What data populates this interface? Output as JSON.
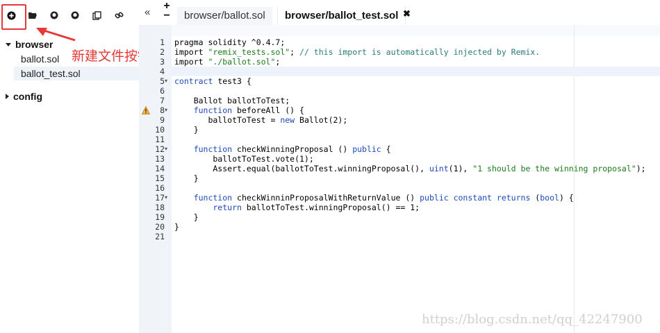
{
  "toolbar": {
    "buttons": [
      {
        "icon": "plus-circle-icon",
        "glyph": "⊕"
      },
      {
        "icon": "folder-open-icon",
        "glyph": "📂"
      },
      {
        "icon": "github-icon",
        "glyph": "◑"
      },
      {
        "icon": "github-icon",
        "glyph": "◑"
      },
      {
        "icon": "copy-icon",
        "glyph": "⧉"
      },
      {
        "icon": "link-icon",
        "glyph": "🔗"
      }
    ]
  },
  "annotation": {
    "text": "新建文件按钮",
    "color": "#e53935"
  },
  "tree": {
    "folders": [
      {
        "label": "browser",
        "expanded": true,
        "files": [
          {
            "label": "ballot.sol"
          },
          {
            "label": "ballot_test.sol",
            "active": true
          }
        ]
      },
      {
        "label": "config",
        "expanded": false
      }
    ]
  },
  "tabs": {
    "left_arrow": "«",
    "plus": "+",
    "minus": "−",
    "items": [
      {
        "label": "browser/ballot.sol",
        "active": false
      },
      {
        "label": "browser/ballot_test.sol",
        "active": true
      }
    ],
    "close": "✖"
  },
  "editor": {
    "current_line": 4,
    "warning_line": 8,
    "lines": [
      {
        "n": "1",
        "tokens": [
          [
            "kw2",
            "pragma solidity "
          ],
          [
            "op",
            "^"
          ],
          [
            "num",
            "0.4.7"
          ],
          [
            "op",
            ";"
          ]
        ]
      },
      {
        "n": "2",
        "tokens": [
          [
            "id",
            "import "
          ],
          [
            "str",
            "\"remix_tests.sol\""
          ],
          [
            "op",
            "; "
          ],
          [
            "cm",
            "// this import is automatically injected by Remix."
          ]
        ]
      },
      {
        "n": "3",
        "tokens": [
          [
            "id",
            "import "
          ],
          [
            "str",
            "\"./ballot.sol\""
          ],
          [
            "op",
            ";"
          ]
        ]
      },
      {
        "n": "4",
        "tokens": []
      },
      {
        "n": "5",
        "fold": true,
        "tokens": [
          [
            "kw",
            "contract"
          ],
          [
            "id",
            " test3 {"
          ]
        ]
      },
      {
        "n": "6",
        "tokens": []
      },
      {
        "n": "7",
        "tokens": [
          [
            "id",
            "    Ballot ballotToTest;"
          ]
        ]
      },
      {
        "n": "8",
        "fold": true,
        "tokens": [
          [
            "kw",
            "    function "
          ],
          [
            "id",
            "beforeAll () {"
          ]
        ]
      },
      {
        "n": "9",
        "tokens": [
          [
            "id",
            "       ballotToTest = "
          ],
          [
            "kw",
            "new"
          ],
          [
            "id",
            " Ballot(2);"
          ]
        ]
      },
      {
        "n": "10",
        "tokens": [
          [
            "id",
            "    }"
          ]
        ]
      },
      {
        "n": "11",
        "tokens": []
      },
      {
        "n": "12",
        "fold": true,
        "tokens": [
          [
            "kw",
            "    function "
          ],
          [
            "id",
            "checkWinningProposal () "
          ],
          [
            "kw",
            "public"
          ],
          [
            "id",
            " {"
          ]
        ]
      },
      {
        "n": "13",
        "tokens": [
          [
            "id",
            "        ballotToTest.vote(1);"
          ]
        ]
      },
      {
        "n": "14",
        "tokens": [
          [
            "id",
            "        Assert.equal(ballotToTest.winningProposal(), "
          ],
          [
            "kw",
            "uint"
          ],
          [
            "id",
            "(1), "
          ],
          [
            "str",
            "\"1 should be the winning proposal\""
          ],
          [
            "id",
            ");"
          ]
        ]
      },
      {
        "n": "15",
        "tokens": [
          [
            "id",
            "    }"
          ]
        ]
      },
      {
        "n": "16",
        "tokens": []
      },
      {
        "n": "17",
        "fold": true,
        "tokens": [
          [
            "kw",
            "    function "
          ],
          [
            "id",
            "checkWinninProposalWithReturnValue () "
          ],
          [
            "kw",
            "public constant returns "
          ],
          [
            "id",
            "("
          ],
          [
            "kw",
            "bool"
          ],
          [
            "id",
            ") {"
          ]
        ]
      },
      {
        "n": "18",
        "tokens": [
          [
            "kw",
            "        return"
          ],
          [
            "id",
            " ballotToTest.winningProposal() == 1;"
          ]
        ]
      },
      {
        "n": "19",
        "tokens": [
          [
            "id",
            "    }"
          ]
        ]
      },
      {
        "n": "20",
        "tokens": [
          [
            "id",
            "}"
          ]
        ]
      },
      {
        "n": "21",
        "tokens": []
      }
    ]
  },
  "watermark": "https://blog.csdn.net/qq_42247900",
  "colors": {
    "keyword": "#1d48b8",
    "string": "#1a7a1a",
    "comment": "#2a7a7a",
    "accent": "#e53935",
    "gutter": "#f0f3f8"
  }
}
